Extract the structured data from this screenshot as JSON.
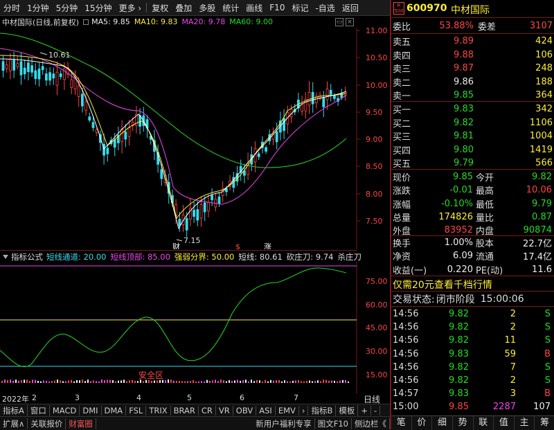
{
  "toolbar": {
    "period_tabs": [
      "分时",
      "1分钟",
      "5分钟",
      "15分钟",
      "更多 ›"
    ],
    "actions": [
      "复权",
      "叠加",
      "多股",
      "统计",
      "画线",
      "F10",
      "标记",
      "-自选",
      "返回"
    ]
  },
  "main_header": {
    "name": "中材国际(日线,前复权)",
    "ma5": "MA5: 9.85",
    "ma10": "MA10: 9.83",
    "ma20": "MA20: 9.78",
    "ma60": "MA60: 9.00"
  },
  "price_axis": [
    "11.00",
    "10.50",
    "10.00",
    "9.50",
    "9.00",
    "8.50",
    "8.00",
    "7.50"
  ],
  "price_labels": {
    "high": "10.61",
    "low": "7.15"
  },
  "event_markers": [
    "财",
    "$",
    "涨"
  ],
  "indicator_header": {
    "label": "指标公式",
    "short_channel": "短线通道: 20.00",
    "short_top": "短线顶部: 85.00",
    "strong_weak": "强弱分界: 50.00",
    "short_line": "短线: 80.61",
    "cut_zhuang": "砍庄刀: 9.74",
    "kill_zhuang": "杀庄刀"
  },
  "indicator_axis": [
    "75.00",
    "60.00",
    "45.00",
    "30.00",
    "15.00"
  ],
  "safe_zone_label": "安全区",
  "date_axis": {
    "year": "2022年",
    "months": [
      "2",
      "3",
      "4",
      "5",
      "6",
      "7"
    ],
    "period": "日线"
  },
  "tabs_row1": [
    "指标A",
    "窗口",
    "MACD",
    "DMI",
    "DMA",
    "FSL",
    "TRIX",
    "BRAR",
    "CR",
    "VR",
    "OBV",
    "ASI",
    "EMV",
    "›",
    "指标B",
    "模板",
    "+",
    "-"
  ],
  "tabs_row2": [
    "扩展∧",
    "关联报价",
    "财富圈",
    "新用户福利专享",
    "图文F10",
    "侧边栏《"
  ],
  "quote": {
    "code": "600970",
    "name": "中材国际",
    "badge_top": "R",
    "badge_bot": "500",
    "weibi_label": "委比",
    "weibi": "53.88%",
    "weicha_label": "委差",
    "weicha": "3107",
    "asks": [
      {
        "label": "卖五",
        "price": "9.89",
        "vol": "424"
      },
      {
        "label": "卖四",
        "price": "9.88",
        "vol": "106"
      },
      {
        "label": "卖三",
        "price": "9.87",
        "vol": "248"
      },
      {
        "label": "卖二",
        "price": "9.86",
        "vol": "188"
      },
      {
        "label": "卖一",
        "price": "9.85",
        "vol": "364"
      }
    ],
    "bids": [
      {
        "label": "买一",
        "price": "9.83",
        "vol": "342"
      },
      {
        "label": "买二",
        "price": "9.82",
        "vol": "1106"
      },
      {
        "label": "买三",
        "price": "9.81",
        "vol": "1004"
      },
      {
        "label": "买四",
        "price": "9.80",
        "vol": "1419"
      },
      {
        "label": "买五",
        "price": "9.79",
        "vol": "566"
      }
    ],
    "stats": [
      {
        "l1": "现价",
        "v1": "9.85",
        "l2": "今开",
        "v2": "9.82"
      },
      {
        "l1": "涨跌",
        "v1": "-0.01",
        "l2": "最高",
        "v2": "10.06"
      },
      {
        "l1": "涨幅",
        "v1": "-0.10%",
        "l2": "最低",
        "v2": "9.79"
      },
      {
        "l1": "总量",
        "v1": "174826",
        "l2": "量比",
        "v2": "0.87"
      },
      {
        "l1": "外盘",
        "v1": "83952",
        "l2": "内盘",
        "v2": "90874"
      }
    ],
    "stats2": [
      {
        "l1": "换手",
        "v1": "1.00%",
        "l2": "股本",
        "v2": "22.7亿"
      },
      {
        "l1": "净资",
        "v1": "6.09",
        "l2": "流通",
        "v2": "17.4亿"
      },
      {
        "l1": "收益(一)",
        "v1": "0.220",
        "l2": "PE(动)",
        "v2": "11.6"
      }
    ],
    "promo": "仅需20元查看千档行情",
    "trade_status_label": "交易状态:",
    "trade_status": "闭市阶段",
    "trade_time": "15:00:06",
    "ticks": [
      {
        "t": "14:56",
        "p": "9.82",
        "v": "2",
        "d": "S"
      },
      {
        "t": "14:56",
        "p": "9.82",
        "v": "2",
        "d": "S"
      },
      {
        "t": "14:56",
        "p": "9.82",
        "v": "11",
        "d": "S"
      },
      {
        "t": "14:56",
        "p": "9.83",
        "v": "59",
        "d": "B"
      },
      {
        "t": "14:56",
        "p": "9.82",
        "v": "7",
        "d": "S"
      },
      {
        "t": "14:56",
        "p": "9.82",
        "v": "2",
        "d": "S"
      },
      {
        "t": "14:57",
        "p": "9.83",
        "v": "3",
        "d": "B"
      },
      {
        "t": "15:00",
        "p": "9.85",
        "v": "2287",
        "d": "107"
      }
    ],
    "bottom_tabs": [
      "笔",
      "价",
      "细",
      "势",
      "联",
      "值",
      "主",
      "筹"
    ]
  }
}
